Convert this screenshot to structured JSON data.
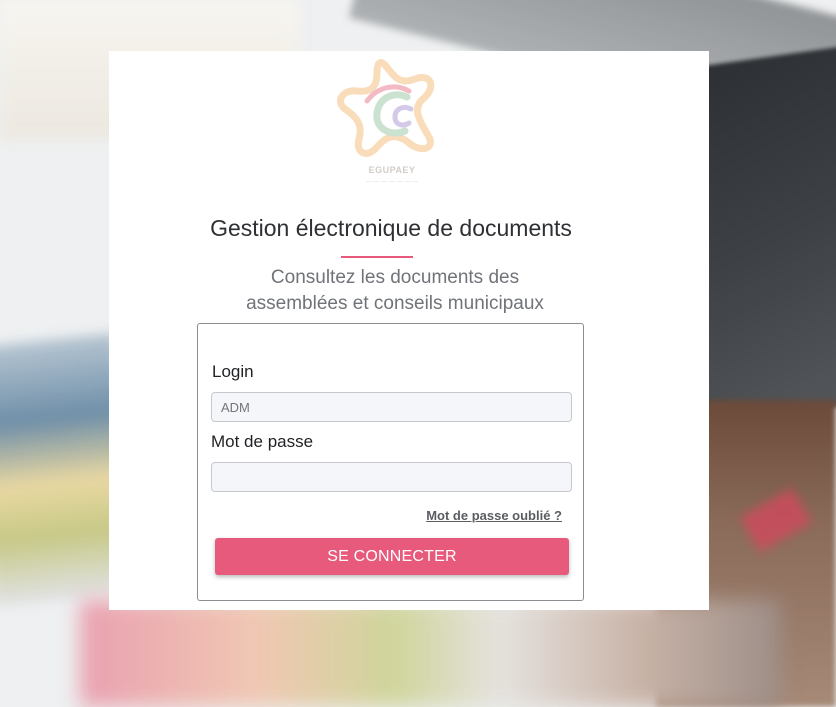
{
  "logo": {
    "brand_text": "EGUPAEY",
    "colors": {
      "star_orange": "#f3b56a",
      "star_red": "#e8677e",
      "swirl_green": "#8fc09a",
      "swirl_purple": "#a38ad0"
    }
  },
  "header": {
    "title": "Gestion électronique de documents",
    "subtitle_line1": "Consultez les documents des",
    "subtitle_line2": "assemblées et conseils municipaux"
  },
  "form": {
    "login_label": "Login",
    "login_value": "",
    "login_placeholder": "ADM",
    "password_label": "Mot de passe",
    "password_value": "",
    "forgot_link": "Mot de passe oublié ?",
    "submit_label": "SE CONNECTER"
  },
  "colors": {
    "accent": "#e75a7b",
    "title_text": "#2e3033",
    "subtitle_text": "#707378"
  }
}
